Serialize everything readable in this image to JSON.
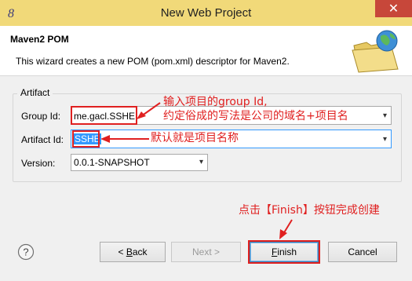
{
  "window": {
    "title": "New Web Project",
    "close_glyph": "✕",
    "icon": "eclipse-icon"
  },
  "header": {
    "title": "Maven2 POM",
    "description": "This wizard creates a new POM (pom.xml) descriptor for Maven2.",
    "graphic": "folder-globe-icon"
  },
  "artifact": {
    "legend": "Artifact",
    "group_id": {
      "label": "Group Id:",
      "value": "me.gacl.SSHE"
    },
    "artifact_id": {
      "label": "Artifact Id:",
      "value": "SSHE"
    },
    "version": {
      "label": "Version:",
      "value": "0.0.1-SNAPSHOT"
    }
  },
  "annotations": {
    "group_line1": "输入项目的group Id,",
    "group_line2": "约定俗成的写法是公司的域名+项目名",
    "artifact_note": "默认就是项目名称",
    "finish_note": "点击【Finish】按钮完成创建",
    "color": "#e02020"
  },
  "buttons": {
    "back": {
      "prefix": "< ",
      "mnemonic": "B",
      "rest": "ack"
    },
    "next": "Next >",
    "finish": {
      "mnemonic": "F",
      "rest": "inish"
    },
    "cancel": "Cancel",
    "help_glyph": "?"
  },
  "colors": {
    "titlebar": "#f1d979",
    "close": "#c7473a",
    "accent_select": "#3399ff"
  }
}
